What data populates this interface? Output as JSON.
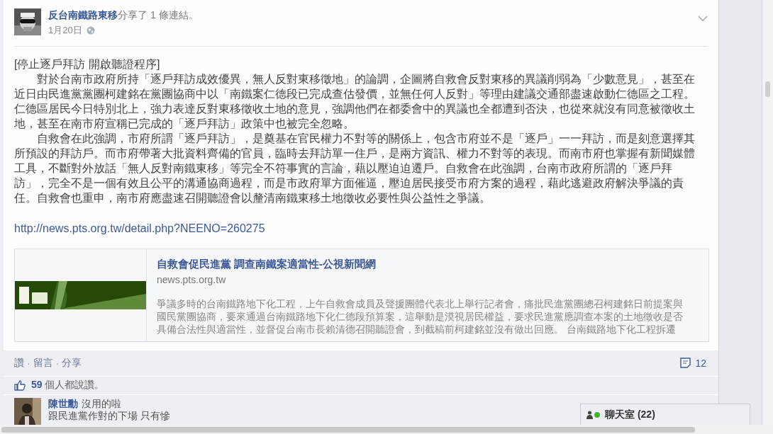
{
  "post": {
    "author": "反台南鐵路東移",
    "action_text": "分享了 1 條連結。",
    "date": "1月20日",
    "title": "[停止逐戶拜訪 開啟聽證程序]",
    "paragraphs": [
      "對於台南市政府所持「逐戶拜訪成效優異，無人反對東移徵地」的論調，企圖將自救會反對東移的異議削弱為「少數意見」，甚至在近日由民進黨黨團柯建銘在黨團協商中以「南鐵案仁德段已完成查估發價，並無任何人反對」等理由建議交通部盡速啟動仁德區之工程。仁德區居民今日特別北上，強力表達反對東移徵收土地的意見，強調他們在都委會中的異議也全都遭到否決，也從來就沒有同意被徵收土地，甚至在南市府宣稱已完成的「逐戶拜訪」政策中也被完全忽略。",
      "自救會在此強調，市府所謂「逐戶拜訪」，是奠基在官民權力不對等的關係上，包含市府並不是「逐戶」一一拜訪，而是刻意選擇其所預設的拜訪戶。而市府帶著大批資料齊備的官員，臨時去拜訪單一住戶，是兩方資訊、權力不對等的表現。而南市府也掌握有新聞媒體工具，不斷對外放話「無人反對南鐵東移」等完全不符事實的言論，藉以壓迫迫遷戶。自救會在此強調，台南市政府所謂的「逐戶拜訪」，完全不是一個有效且公平的溝通協商過程，而是市政府單方面催逼，壓迫居民接受市府方案的過程，藉此逃避政府解決爭議的責任。自救會也重申，南市府應盡速召開聽證會以釐清南鐵東移土地徵收必要性與公益性之爭議。"
    ],
    "url": "http://news.pts.org.tw/detail.php?NEENO=260275",
    "link_card": {
      "title": "自救會促民進黨 調查南鐵案適當性-公視新聞網",
      "domain": "news.pts.org.tw",
      "description": "爭議多時的台南鐵路地下化工程，上午自救會成員及聲援團體代表北上舉行記者會，痛批民進黨團總召柯建銘日前提案與國民黨團協商，要來通過台南鐵路地下化仁德段預算案，這舉動是漠視居民權益，要求民進黨應調查本案的土地徵收是否具備合法性與適當性，並督促台南市長賴清德召開聽證會，到截稿前柯建銘並沒有做出回應。 台南鐵路地下化工程拆遷"
    },
    "actions": [
      "讚",
      "留言",
      "分享"
    ],
    "separator": "·",
    "comment_count": "12",
    "likes": {
      "count": "59",
      "text": "個人都說讚。"
    },
    "comments": [
      {
        "author": "陳世勳",
        "lines": [
          "沒用的啦",
          "跟民進黨作對的下場 只有慘"
        ]
      }
    ]
  },
  "chat": {
    "label": "聊天室",
    "count": "(22)"
  }
}
